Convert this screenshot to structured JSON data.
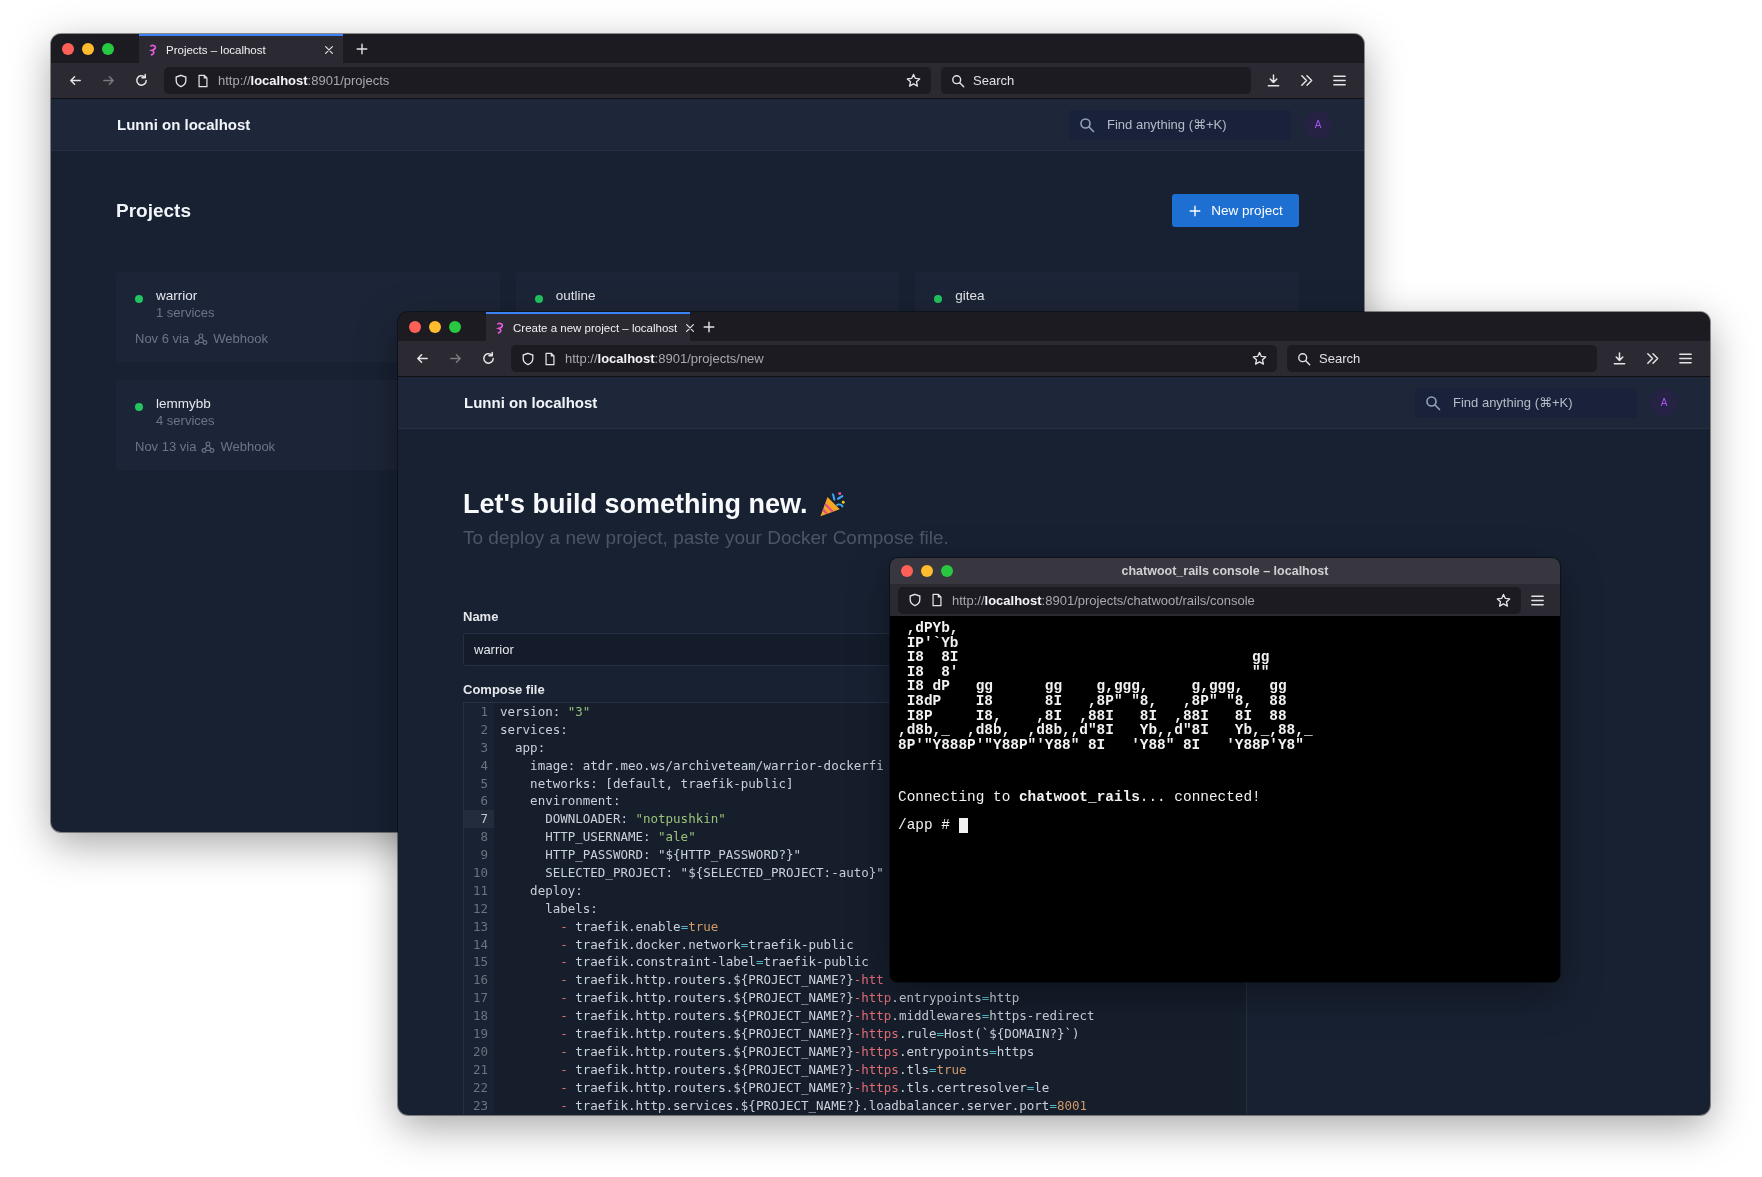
{
  "back_window": {
    "tab_title": "Projects – localhost",
    "url": "http://**localhost**:8901/projects",
    "search_placeholder": "Search",
    "forward_disabled": true,
    "app": {
      "brand": "Lunni on localhost",
      "find_placeholder": "Find anything (⌘+K)",
      "avatar": "A"
    },
    "page_title": "Projects",
    "new_button": "New project",
    "projects": [
      {
        "name": "warrior",
        "services": "1 services",
        "date": "Nov 6 via",
        "trigger": "Webhook",
        "color": "#22c55e"
      },
      {
        "name": "outline",
        "color": "#22c55e"
      },
      {
        "name": "gitea",
        "color": "#22c55e"
      },
      {
        "name": "lemmybb",
        "services": "4 services",
        "date": "Nov 13 via",
        "trigger": "Webhook",
        "color": "#22c55e"
      }
    ]
  },
  "front_window": {
    "tab_title": "Create a new project – localhost",
    "url": "http://**localhost**:8901/projects/new",
    "search_placeholder": "Search",
    "forward_disabled": true,
    "app": {
      "brand": "Lunni on localhost",
      "find_placeholder": "Find anything (⌘+K)",
      "avatar": "A"
    },
    "heading": "Let's build something new.",
    "subtitle": "To deploy a new project, paste your Docker Compose file.",
    "name_label": "Name",
    "name_value": "warrior",
    "compose_label": "Compose file",
    "code_lines": [
      {
        "number": "1",
        "active": false,
        "tokens": [
          {
            "kind": "key",
            "text": "version: "
          },
          {
            "kind": "str",
            "text": "\"3\""
          }
        ]
      },
      {
        "number": "2",
        "active": false,
        "tokens": [
          {
            "kind": "key",
            "text": "services:"
          }
        ]
      },
      {
        "number": "3",
        "active": false,
        "tokens": [
          {
            "kind": "key",
            "text": "  app:"
          }
        ]
      },
      {
        "number": "4",
        "active": false,
        "tokens": [
          {
            "kind": "key",
            "text": "    image: atdr.meo.ws/archiveteam/warrior-dockerfi"
          }
        ]
      },
      {
        "number": "5",
        "active": false,
        "tokens": [
          {
            "kind": "key",
            "text": "    networks: [default, traefik-public]"
          }
        ]
      },
      {
        "number": "6",
        "active": false,
        "tokens": [
          {
            "kind": "key",
            "text": "    environment:"
          }
        ]
      },
      {
        "number": "7",
        "active": true,
        "tokens": [
          {
            "kind": "key",
            "text": "      DOWNLOADER: "
          },
          {
            "kind": "str",
            "text": "\"notpushkin\""
          }
        ]
      },
      {
        "number": "8",
        "active": false,
        "tokens": [
          {
            "kind": "key",
            "text": "      HTTP_USERNAME: "
          },
          {
            "kind": "str",
            "text": "\"ale\""
          }
        ]
      },
      {
        "number": "9",
        "active": false,
        "tokens": [
          {
            "kind": "key",
            "text": "      HTTP_PASSWORD: \"${HTTP_PASSWORD?}\""
          }
        ]
      },
      {
        "number": "10",
        "active": false,
        "tokens": [
          {
            "kind": "key",
            "text": "      SELECTED_PROJECT: \"${SELECTED_PROJECT:-auto}\""
          }
        ]
      },
      {
        "number": "11",
        "active": false,
        "tokens": [
          {
            "kind": "key",
            "text": "    deploy:"
          }
        ]
      },
      {
        "number": "12",
        "active": false,
        "tokens": [
          {
            "kind": "key",
            "text": "      labels:"
          }
        ]
      },
      {
        "number": "13",
        "active": false,
        "tokens": [
          {
            "kind": "dash",
            "text": "        -"
          },
          {
            "kind": "key",
            "text": " traefik.enable"
          },
          {
            "kind": "op",
            "text": "="
          },
          {
            "kind": "lit",
            "text": "true"
          }
        ]
      },
      {
        "number": "14",
        "active": false,
        "tokens": [
          {
            "kind": "dash",
            "text": "        -"
          },
          {
            "kind": "key",
            "text": " traefik.docker.network"
          },
          {
            "kind": "op",
            "text": "="
          },
          {
            "kind": "key",
            "text": "traefik-public"
          }
        ]
      },
      {
        "number": "15",
        "active": false,
        "tokens": [
          {
            "kind": "dash",
            "text": "        -"
          },
          {
            "kind": "key",
            "text": " traefik.constraint-label"
          },
          {
            "kind": "op",
            "text": "="
          },
          {
            "kind": "key",
            "text": "traefik-public"
          }
        ]
      },
      {
        "number": "16",
        "active": false,
        "tokens": [
          {
            "kind": "dash",
            "text": "        -"
          },
          {
            "kind": "key",
            "text": " traefik.http.routers.${PROJECT_NAME?}"
          },
          {
            "kind": "red",
            "text": "-htt"
          }
        ]
      },
      {
        "number": "17",
        "active": false,
        "tokens": [
          {
            "kind": "dash",
            "text": "        -"
          },
          {
            "kind": "key",
            "text": " traefik.http.routers.${PROJECT_NAME?}"
          },
          {
            "kind": "red",
            "text": "-http"
          },
          {
            "kind": "key",
            "text": ".entrypoints"
          },
          {
            "kind": "op",
            "text": "="
          },
          {
            "kind": "key",
            "text": "http"
          }
        ]
      },
      {
        "number": "18",
        "active": false,
        "tokens": [
          {
            "kind": "dash",
            "text": "        -"
          },
          {
            "kind": "key",
            "text": " traefik.http.routers.${PROJECT_NAME?}"
          },
          {
            "kind": "red",
            "text": "-http"
          },
          {
            "kind": "key",
            "text": ".middlewares"
          },
          {
            "kind": "op",
            "text": "="
          },
          {
            "kind": "key",
            "text": "https-redirect"
          }
        ]
      },
      {
        "number": "19",
        "active": false,
        "tokens": [
          {
            "kind": "dash",
            "text": "        -"
          },
          {
            "kind": "key",
            "text": " traefik.http.routers.${PROJECT_NAME?}"
          },
          {
            "kind": "red",
            "text": "-https"
          },
          {
            "kind": "key",
            "text": ".rule"
          },
          {
            "kind": "op",
            "text": "="
          },
          {
            "kind": "key",
            "text": "Host(`${DOMAIN?}`)"
          }
        ]
      },
      {
        "number": "20",
        "active": false,
        "tokens": [
          {
            "kind": "dash",
            "text": "        -"
          },
          {
            "kind": "key",
            "text": " traefik.http.routers.${PROJECT_NAME?}"
          },
          {
            "kind": "red",
            "text": "-https"
          },
          {
            "kind": "key",
            "text": ".entrypoints"
          },
          {
            "kind": "op",
            "text": "="
          },
          {
            "kind": "key",
            "text": "https"
          }
        ]
      },
      {
        "number": "21",
        "active": false,
        "tokens": [
          {
            "kind": "dash",
            "text": "        -"
          },
          {
            "kind": "key",
            "text": " traefik.http.routers.${PROJECT_NAME?}"
          },
          {
            "kind": "red",
            "text": "-https"
          },
          {
            "kind": "key",
            "text": ".tls"
          },
          {
            "kind": "op",
            "text": "="
          },
          {
            "kind": "lit",
            "text": "true"
          }
        ]
      },
      {
        "number": "22",
        "active": false,
        "tokens": [
          {
            "kind": "dash",
            "text": "        -"
          },
          {
            "kind": "key",
            "text": " traefik.http.routers.${PROJECT_NAME?}"
          },
          {
            "kind": "red",
            "text": "-https"
          },
          {
            "kind": "key",
            "text": ".tls.certresolver"
          },
          {
            "kind": "op",
            "text": "="
          },
          {
            "kind": "key",
            "text": "le"
          }
        ]
      },
      {
        "number": "23",
        "active": false,
        "tokens": [
          {
            "kind": "dash",
            "text": "        -"
          },
          {
            "kind": "key",
            "text": " traefik.http.services.${PROJECT_NAME?}.loadbalancer.server.port"
          },
          {
            "kind": "op",
            "text": "="
          },
          {
            "kind": "lit",
            "text": "8001"
          }
        ]
      }
    ]
  },
  "console_window": {
    "title": "chatwoot_rails console – localhost",
    "url": "http://**localhost**:8901/projects/chatwoot/rails/console",
    "banner": [
      " ,dPYb,",
      " IP'`Yb",
      " I8  8I                                  gg",
      " I8  8'                                  \"\"",
      " I8 dP   gg      gg    g,ggg,     g,ggg,   gg",
      " I8dP    I8      8I   ,8P\" \"8,   ,8P\" \"8,  88",
      " I8P     I8,    ,8I  ,88I   8I  ,88I   8I  88",
      ",d8b,_  ,d8b,  ,d8b,,d\"8I   Yb,,d\"8I   Yb,_,88,_",
      "8P'\"Y888P'\"Y88P\"'Y88\" 8I   'Y88\" 8I   'Y88P'Y8\""
    ],
    "status": "Connecting to **chatwoot_rails**... connected!",
    "prompt": "/app #"
  }
}
